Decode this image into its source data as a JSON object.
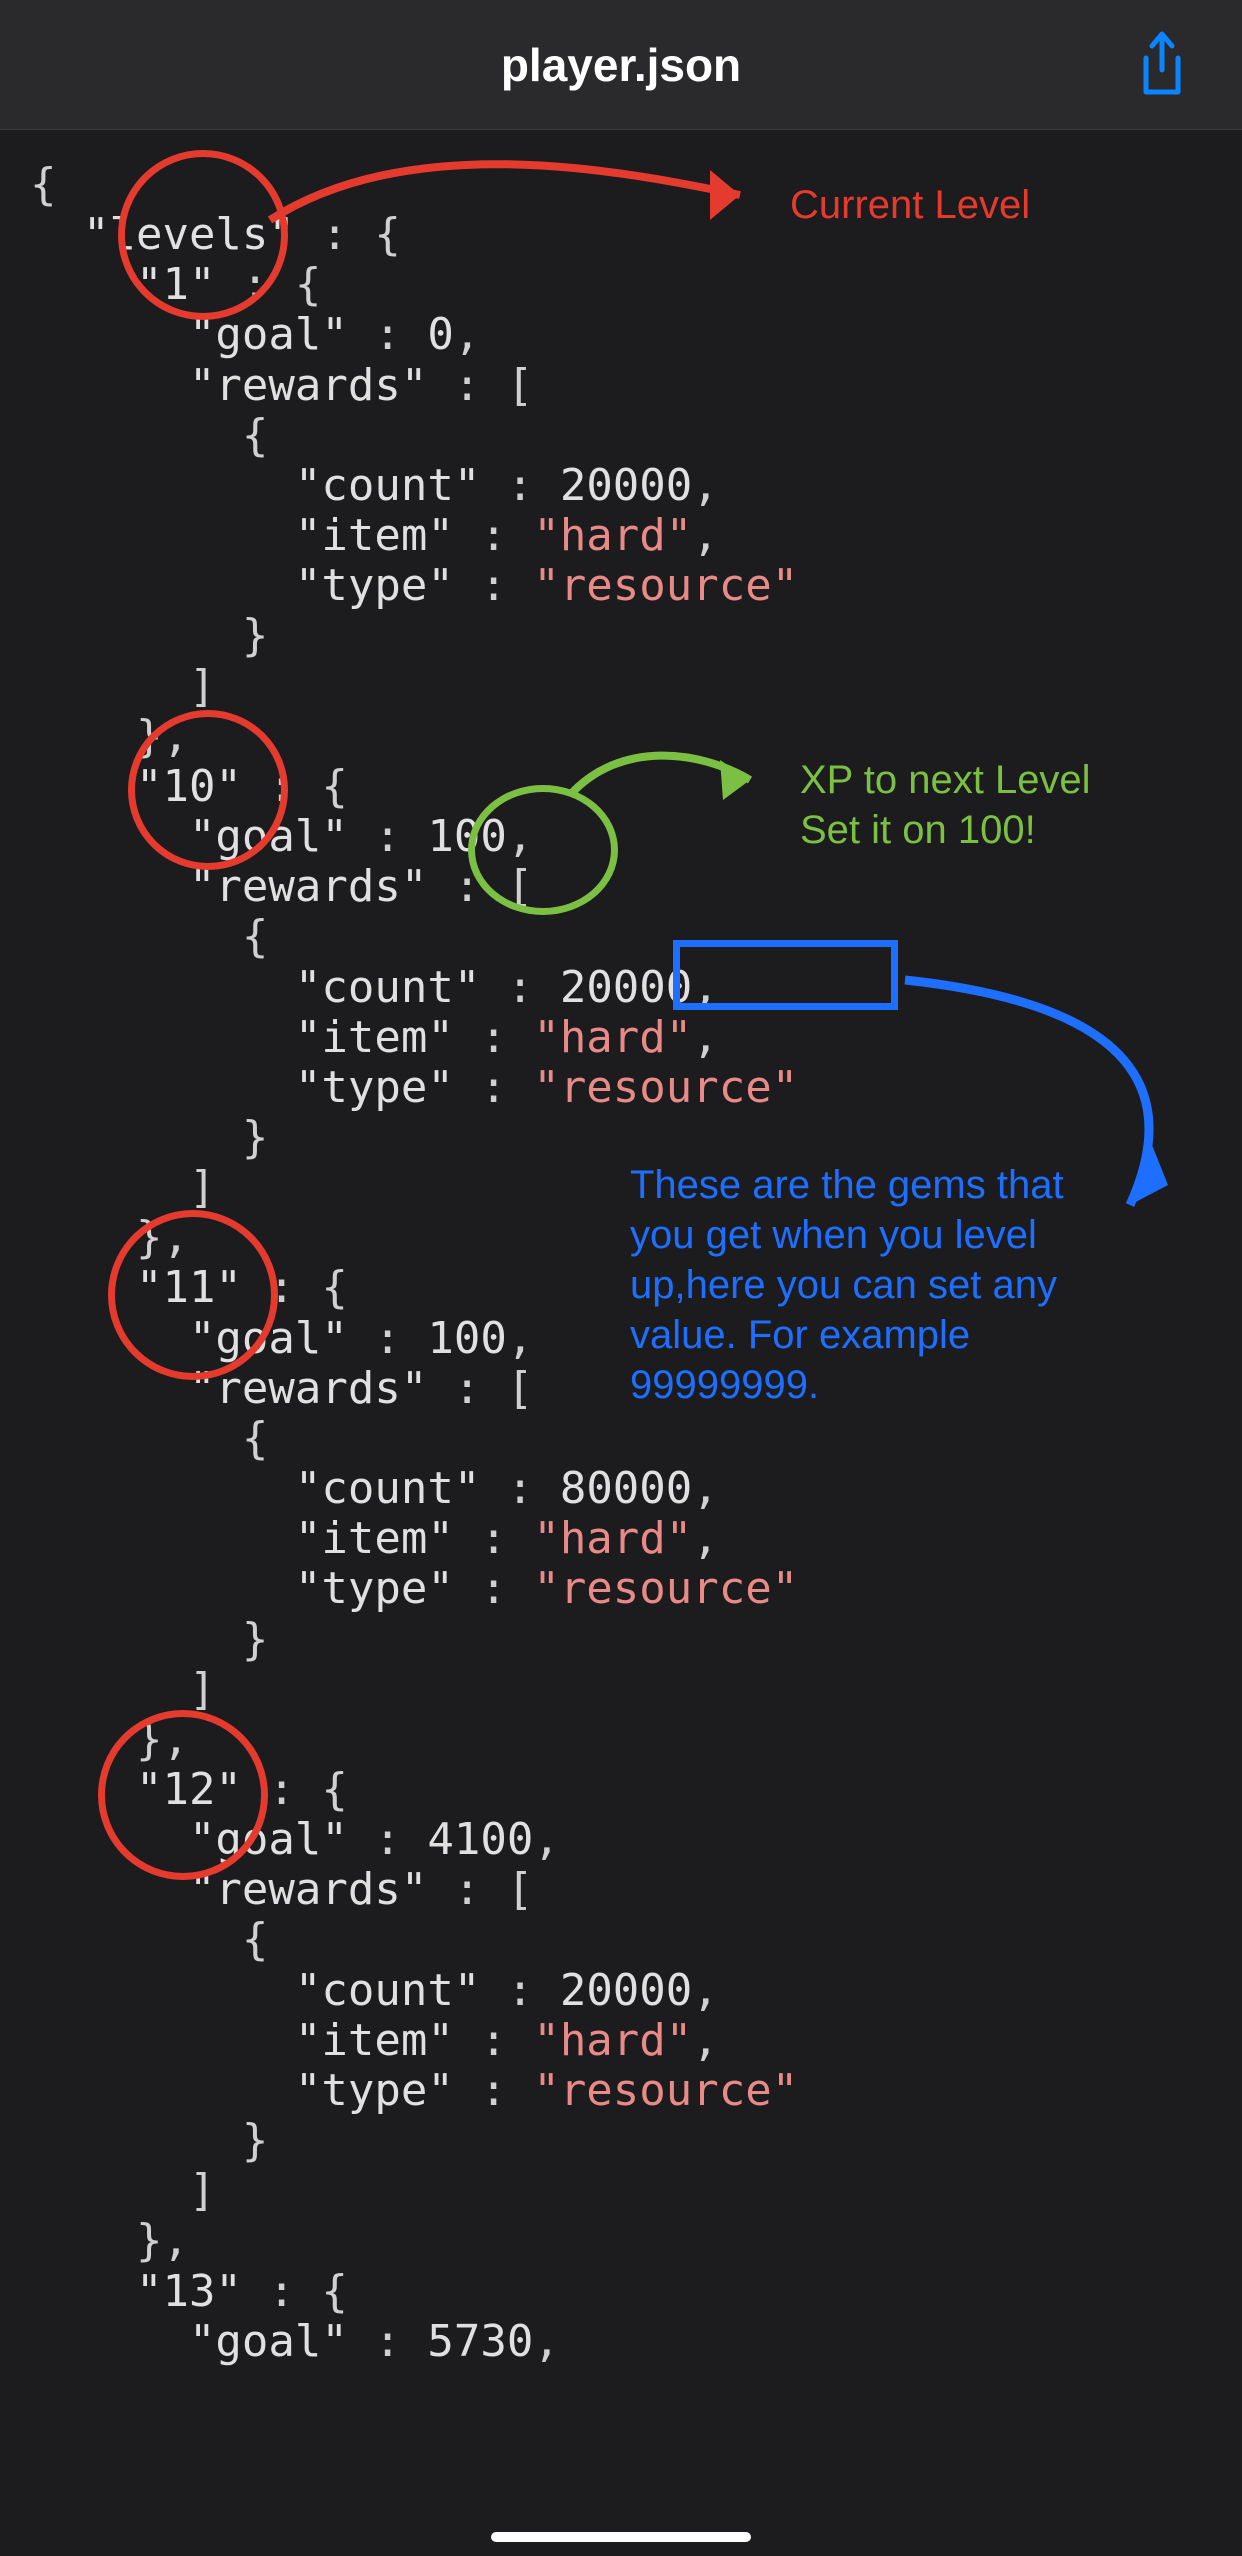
{
  "header": {
    "title": "player.json"
  },
  "code": {
    "l0": "{",
    "l1a": "  \"levels\"",
    "l1b": " : {",
    "l2a": "    \"1\"",
    "l2b": " : {",
    "l3a": "      \"goal\"",
    "l3b": " : ",
    "l3c": "0",
    "l3d": ",",
    "l4a": "      \"rewards\"",
    "l4b": " : [",
    "l5": "        {",
    "l6a": "          \"count\"",
    "l6b": " : ",
    "l6c": "20000",
    "l6d": ",",
    "l7a": "          \"item\"",
    "l7b": " : ",
    "l7c": "\"hard\"",
    "l7d": ",",
    "l8a": "          \"type\"",
    "l8b": " : ",
    "l8c": "\"resource\"",
    "l9": "        }",
    "l10": "      ]",
    "l11": "    },",
    "l12a": "    \"10\"",
    "l12b": " : {",
    "l13a": "      \"goal\"",
    "l13b": " : ",
    "l13c": "100",
    "l13d": ",",
    "l14a": "      \"rewards\"",
    "l14b": " : [",
    "l15": "        {",
    "l16a": "          \"count\"",
    "l16b": " : ",
    "l16c": "20000",
    "l16d": ",",
    "l17a": "          \"item\"",
    "l17b": " : ",
    "l17c": "\"hard\"",
    "l17d": ",",
    "l18a": "          \"type\"",
    "l18b": " : ",
    "l18c": "\"resource\"",
    "l19": "        }",
    "l20": "      ]",
    "l21": "    },",
    "l22a": "    \"11\"",
    "l22b": " : {",
    "l23a": "      \"goal\"",
    "l23b": " : ",
    "l23c": "100",
    "l23d": ",",
    "l24a": "      \"rewards\"",
    "l24b": " : [",
    "l25": "        {",
    "l26a": "          \"count\"",
    "l26b": " : ",
    "l26c": "80000",
    "l26d": ",",
    "l27a": "          \"item\"",
    "l27b": " : ",
    "l27c": "\"hard\"",
    "l27d": ",",
    "l28a": "          \"type\"",
    "l28b": " : ",
    "l28c": "\"resource\"",
    "l29": "        }",
    "l30": "      ]",
    "l31": "    },",
    "l32a": "    \"12\"",
    "l32b": " : {",
    "l33a": "      \"goal\"",
    "l33b": " : ",
    "l33c": "4100",
    "l33d": ",",
    "l34a": "      \"rewards\"",
    "l34b": " : [",
    "l35": "        {",
    "l36a": "          \"count\"",
    "l36b": " : ",
    "l36c": "20000",
    "l36d": ",",
    "l37a": "          \"item\"",
    "l37b": " : ",
    "l37c": "\"hard\"",
    "l37d": ",",
    "l38a": "          \"type\"",
    "l38b": " : ",
    "l38c": "\"resource\"",
    "l39": "        }",
    "l40": "      ]",
    "l41": "    },",
    "l42a": "    \"13\"",
    "l42b": " : {",
    "l43a": "      \"goal\"",
    "l43b": " : ",
    "l43c": "5730",
    "l43d": ","
  },
  "annotations": {
    "red1": "Current Level",
    "green1": "XP to next Level",
    "green2": "Set it on 100!",
    "blue1": "These are the gems that",
    "blue2": "you get when you level",
    "blue3": "up,here you can set any",
    "blue4": "value. For example",
    "blue5": "99999999."
  }
}
